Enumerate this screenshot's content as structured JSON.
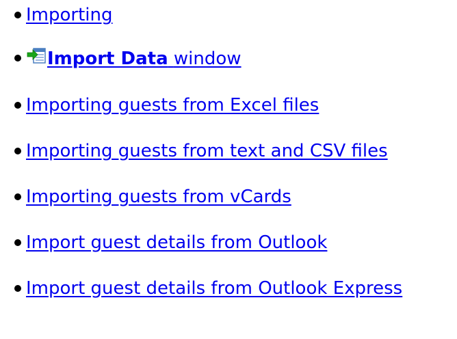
{
  "links": [
    {
      "label": "Importing"
    },
    {
      "bold_label": "Import Data",
      "suffix": "window",
      "icon": "import-data-icon"
    },
    {
      "label": "Importing guests from Excel files"
    },
    {
      "label": "Importing guests from text and CSV files"
    },
    {
      "label": "Importing guests from vCards"
    },
    {
      "label": "Import guest details from Outlook"
    },
    {
      "label": "Import guest details from Outlook Express"
    }
  ],
  "colors": {
    "link": "#0000ee",
    "bullet": "#000000",
    "icon_arrow": "#1aa51a",
    "icon_sheet": "#4a7fc1"
  }
}
